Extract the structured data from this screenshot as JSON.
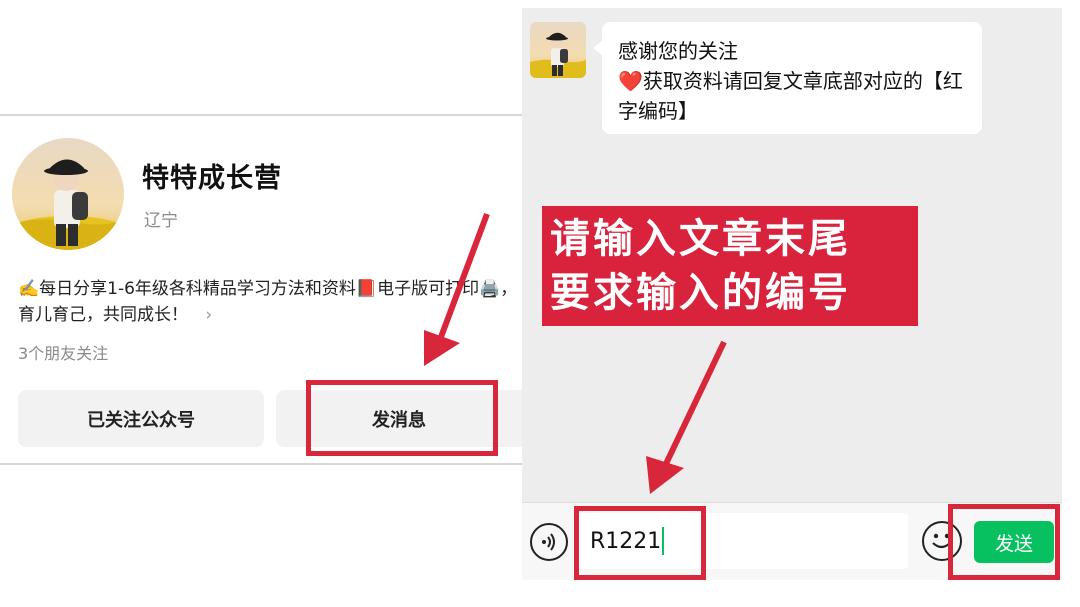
{
  "profile": {
    "name": "特特成长营",
    "location": "辽宁",
    "description": "✍️每日分享1-6年级各科精品学习方法和资料📕电子版可打印🖨️，育儿育己，共同成长！",
    "description_more": "›",
    "followers": "3个朋友关注",
    "followed_button": "已关注公众号",
    "message_button": "发消息"
  },
  "chat": {
    "message_line1": "感谢您的关注",
    "message_heart": "❤️",
    "message_line2": "获取资料请回复文章底部对应的【红字编码】",
    "input_value": "R1221",
    "send_button": "发送"
  },
  "annotation": {
    "line1": "请输入文章末尾",
    "line2": "要求输入的编号"
  },
  "colors": {
    "highlight": "#d8263a",
    "wechat_green": "#07c160",
    "chat_background": "#ededed"
  },
  "icons": [
    "voice-icon",
    "emoji-icon",
    "chevron-right-icon",
    "heart-icon"
  ]
}
